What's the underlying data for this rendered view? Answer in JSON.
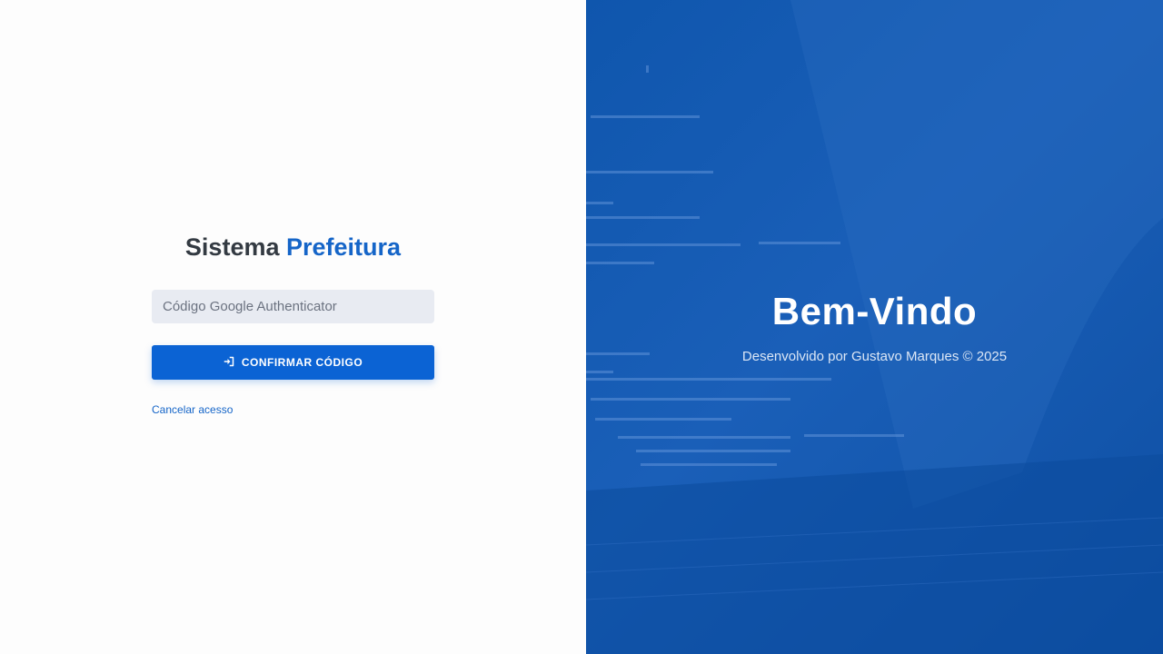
{
  "login": {
    "brand_primary": "Sistema",
    "brand_accent": "Prefeitura",
    "code_placeholder": "Código Google Authenticator",
    "confirm_label": "CONFIRMAR CÓDIGO",
    "confirm_icon": "sign-in-icon",
    "cancel_label": "Cancelar acesso"
  },
  "welcome": {
    "title": "Bem-Vindo",
    "credit": "Desenvolvido por Gustavo Marques © 2025"
  },
  "colors": {
    "accent": "#1565c8",
    "button": "#0b63d4",
    "panel": "#0f56ad"
  }
}
